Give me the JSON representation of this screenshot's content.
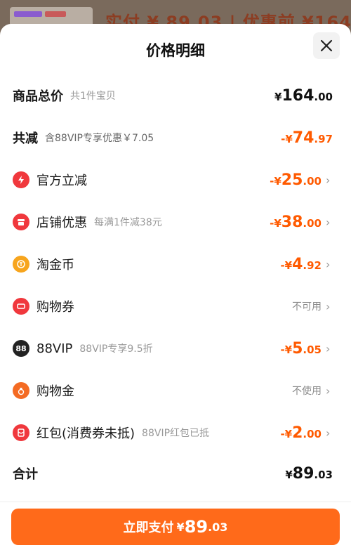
{
  "backdrop": {
    "ghost_text": "实付 ¥ 89.03 | 优惠前 ¥164"
  },
  "header": {
    "title": "价格明细"
  },
  "rows": {
    "total": {
      "label": "商品总价",
      "sub": "共1件宝贝",
      "sym": "¥",
      "int": "164",
      "dec": ".00"
    },
    "reduce": {
      "label": "共减",
      "sub": "含88VIP专享优惠￥7.05",
      "sym": "-¥",
      "int": "74",
      "dec": ".97"
    },
    "official": {
      "label": "官方立减",
      "sym": "-¥",
      "int": "25",
      "dec": ".00",
      "icon": "lightning-icon"
    },
    "store": {
      "label": "店铺优惠",
      "sub": "每满1件减38元",
      "sym": "-¥",
      "int": "38",
      "dec": ".00",
      "icon": "store-icon"
    },
    "coin": {
      "label": "淘金币",
      "sym": "-¥",
      "int": "4",
      "dec": ".92",
      "icon": "coin-icon"
    },
    "coupon": {
      "label": "购物券",
      "status": "不可用",
      "icon": "ticket-icon"
    },
    "vip": {
      "label": "88VIP",
      "sub": "88VIP专享9.5折",
      "sym": "-¥",
      "int": "5",
      "dec": ".05",
      "icon_text": "88"
    },
    "gold": {
      "label": "购物金",
      "status": "不使用",
      "icon": "money-bag-icon"
    },
    "redpacket": {
      "label": "红包(消费券未抵)",
      "sub": "88VIP红包已抵",
      "sym": "-¥",
      "int": "2",
      "dec": ".00",
      "icon": "red-envelope-icon"
    },
    "sum": {
      "label": "合计",
      "sym": "¥",
      "int": "89",
      "dec": ".03"
    }
  },
  "pay": {
    "label": "立即支付",
    "sym": "¥",
    "int": "89",
    "dec": ".03"
  },
  "colors": {
    "accent": "#ff5a00",
    "button": "#ff6a1a",
    "icon_red": "#f0383d"
  }
}
